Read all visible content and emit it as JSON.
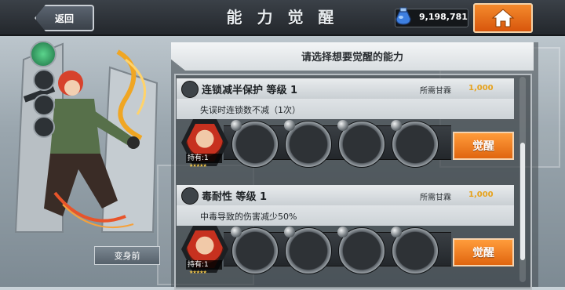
{
  "header": {
    "back_label": "返回",
    "title": "能 力 觉 醒",
    "currency_value": "9,198,781"
  },
  "panel": {
    "prompt": "请选择想要觉醒的能力"
  },
  "left": {
    "transform_label": "变身前"
  },
  "skills": [
    {
      "name": "连锁减半保护 等级 1",
      "cost_label": "所需甘霖",
      "cost_value": "1,000",
      "description": "失误时连锁数不减（1次）",
      "owned_label": "持有:1",
      "stars": "★★★★★",
      "awaken_label": "觉醒",
      "icon": "link-shield-icon"
    },
    {
      "name": "毒耐性 等级 1",
      "cost_label": "所需甘霖",
      "cost_value": "1,000",
      "description": "中毒导致的伤害减少50%",
      "owned_label": "持有:1",
      "stars": "★★★★★",
      "awaken_label": "觉醒",
      "icon": "skull-icon"
    }
  ],
  "colors": {
    "accent_orange": "#e0650f",
    "cost_gold": "#e6a21c",
    "topbar": "#23272c"
  }
}
